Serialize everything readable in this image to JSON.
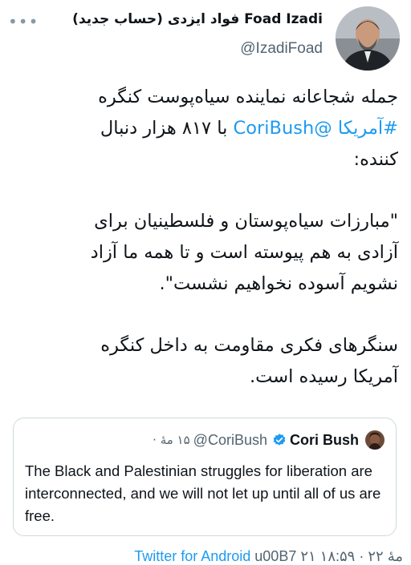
{
  "header": {
    "display_name": "(حساب جدید) فواد ایزدی Foad Izadi",
    "handle": "@IzadiFoad",
    "more_icon": "more-dots-icon"
  },
  "tweet": {
    "line1": "جمله شجاعانه نماینده سیاه‌پوست کنگره",
    "line2_hashtag": "#آمریکا",
    "line2_mention": "@CoriBush",
    "line2_rest": " با ۸۱۷ هزار دنبال",
    "line3": "کننده:",
    "quote_line1": "\"مبارزات سیاه‌پوستان و فلسطینیان برای",
    "quote_line2": "آزادی به هم پیوسته است و تا همه ما آزاد",
    "quote_line3": "نشویم آسوده نخواهیم نشست\".",
    "closing_line1": "سنگرهای فکری مقاومت به داخل کنگره",
    "closing_line2": "آمریکا رسیده است."
  },
  "quoted_tweet": {
    "name": "Cori Bush",
    "handle": "@CoriBush",
    "time": "۱۵ مهٔ ·",
    "verified_color": "#1d9bf0",
    "text": "The Black and Palestinian struggles for liberation are interconnected, and we will not let up until all of us are free."
  },
  "footer": {
    "source": "Twitter for Android",
    "meta": " u00B7 ۲۱ مهٔ ۲۲ · ۱۸:۵۹"
  },
  "colors": {
    "link": "#1d9bf0",
    "secondary": "#536471",
    "border": "#cfd9de"
  }
}
